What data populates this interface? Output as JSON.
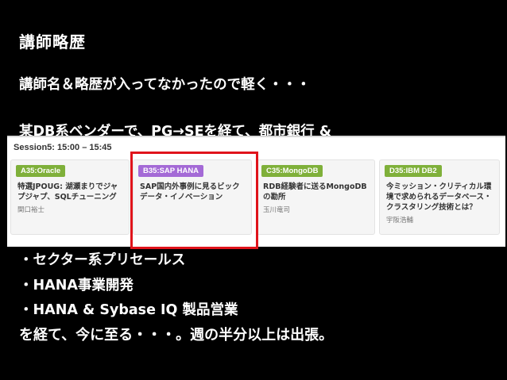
{
  "slide": {
    "title": "講師略歴",
    "line1": "講師名＆略歴が入ってなかったので軽く・・・",
    "line2": "某DB系ベンダーで、PG→SEを経て、都市銀行 &",
    "line3": "・セクター系プリセールス",
    "line4": "・HANA事業開発",
    "line5": "・HANA & Sybase IQ 製品営業",
    "line6": "を経て、今に至る・・・。週の半分以上は出張。"
  },
  "schedule": {
    "session_label": "Session5: 15:00 – 15:45",
    "cards": [
      {
        "tag": "A35:Oracle",
        "tag_color": "#7fb03a",
        "title": "特選JPOUG: 湖瀬まりでジャプジャプ、SQLチューニング",
        "speaker": "関口裕士"
      },
      {
        "tag": "B35:SAP HANA",
        "tag_color": "#a46ad6",
        "title": "SAP国内外事例に見るビックデータ・イノベーション",
        "speaker": ""
      },
      {
        "tag": "C35:MongoDB",
        "tag_color": "#7fb03a",
        "title": "RDB経験者に送るMongoDBの勘所",
        "speaker": "玉川竜司"
      },
      {
        "tag": "D35:IBM DB2",
        "tag_color": "#7fb03a",
        "title": "今ミッション・クリティカル環境で求められるデータベース・クラスタリング技術とは？",
        "speaker": "宇阪浩輔"
      }
    ]
  },
  "colors": {
    "background": "#000000",
    "text": "#ffffff",
    "highlight": "#e0141b"
  }
}
